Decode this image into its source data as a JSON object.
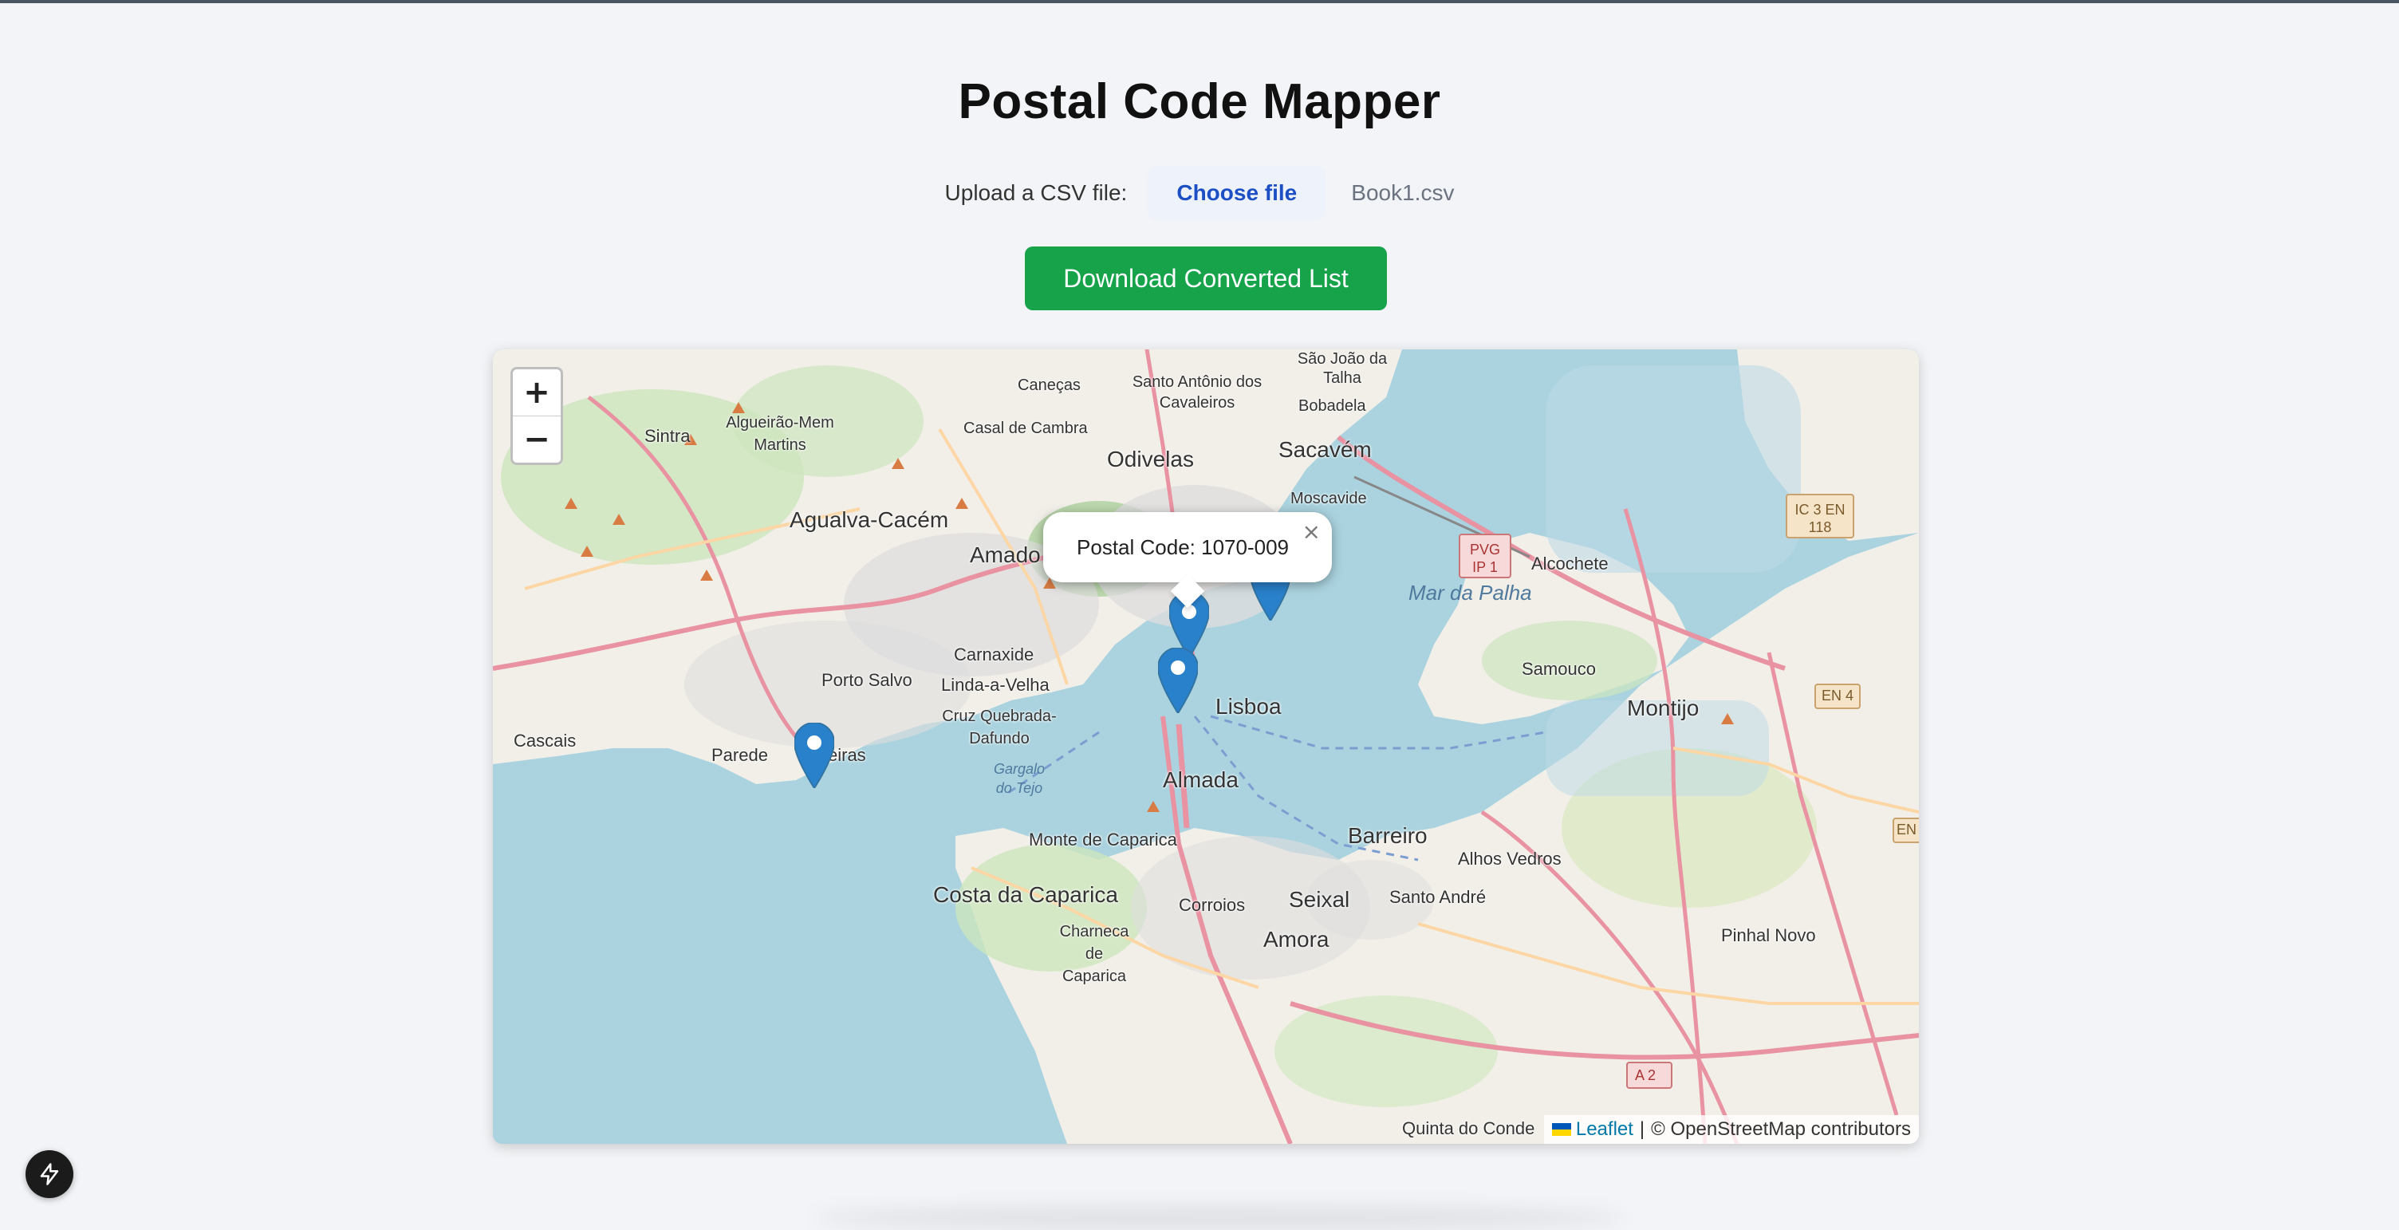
{
  "page": {
    "title": "Postal Code Mapper"
  },
  "upload": {
    "label": "Upload a CSV file:",
    "button_label": "Choose file",
    "file_name": "Book1.csv"
  },
  "download": {
    "label": "Download Converted List"
  },
  "map": {
    "zoom_in": "+",
    "zoom_out": "−",
    "popup": {
      "text": "Postal Code: 1070-009",
      "close": "×"
    },
    "attribution": {
      "leaflet": "Leaflet",
      "separator": "|",
      "osm": "© OpenStreetMap contributors"
    },
    "labels": {
      "sao_joao": "São João da Talha",
      "santo_antonio": "Santo Antônio dos Cavaleiros",
      "bobadela": "Bobadela",
      "canecas": "Caneças",
      "algueirao": "Algueirão-Mem Martins",
      "casal_cambra": "Casal de Cambra",
      "odivelas": "Odivelas",
      "sacavem": "Sacavém",
      "moscavide": "Moscavide",
      "sintra": "Sintra",
      "agualva": "Agualva-Cacém",
      "amadora": "Amado",
      "mar_palha": "Mar da Palha",
      "alcochete": "Alcochete",
      "carnaxide": "Carnaxide",
      "linda": "Linda-a-Velha",
      "porto_salvo": "Porto Salvo",
      "lisboa": "Lisboa",
      "samouco": "Samouco",
      "montijo": "Montijo",
      "cruz": "Cruz Quebrada-Dafundo",
      "cascais": "Cascais",
      "parede": "Parede",
      "oeiras": "eiras",
      "gargalo": "Gargalo do Tejo",
      "almada": "Almada",
      "barreiro": "Barreiro",
      "alhos_vedros": "Alhos Vedros",
      "monte_caparica": "Monte de Caparica",
      "costa_caparica": "Costa da Caparica",
      "corroios": "Corroios",
      "seixal": "Seixal",
      "santo_andre": "Santo André",
      "pinhal_novo": "Pinhal Novo",
      "charneca": "Charneca de Caparica",
      "amora": "Amora",
      "quinta_conde": "Quinta do Conde",
      "pvg": "PVG IP 1",
      "ic3": "IC 3 EN 118",
      "en4": "EN 4",
      "a2": "A 2",
      "en": "EN"
    }
  },
  "colors": {
    "accent_blue": "#1d4fc4",
    "download_green": "#16a34a",
    "marker_blue": "#2a81cb",
    "water": "#aad3df",
    "land": "#f2efe9"
  },
  "icons": {
    "marker": "map-marker-icon",
    "bolt": "lightning-bolt-icon",
    "close": "close-icon"
  }
}
